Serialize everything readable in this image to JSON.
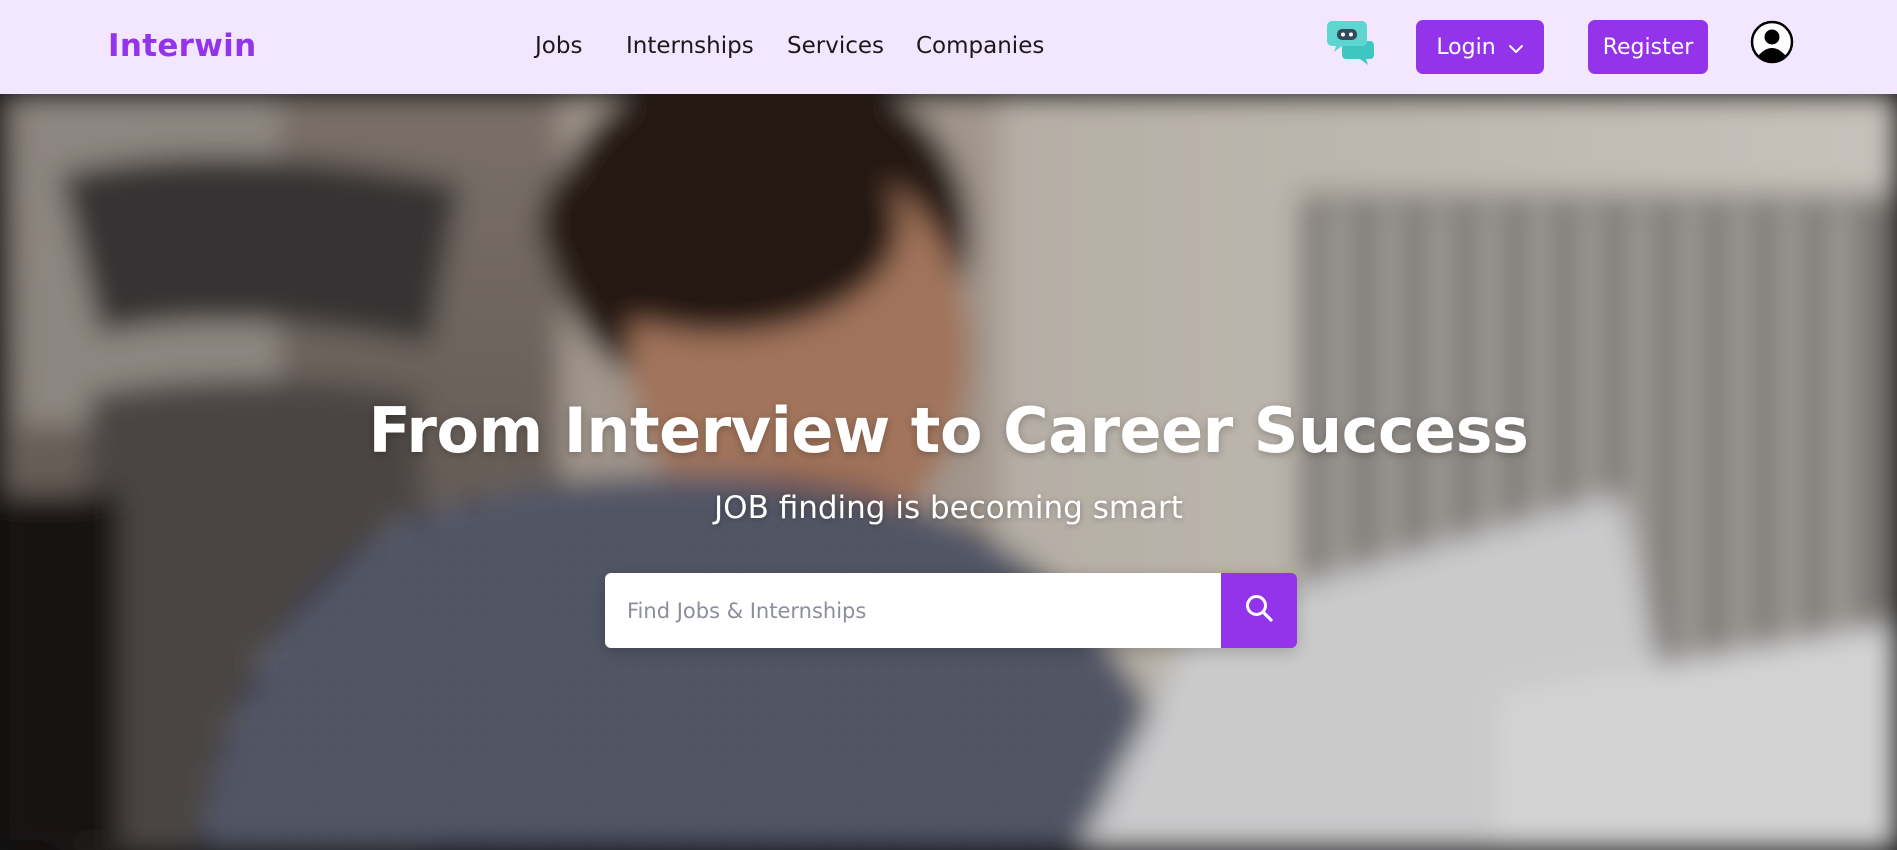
{
  "brand": {
    "name": "Interwin",
    "color": "#9333ea"
  },
  "nav": {
    "links": [
      "Jobs",
      "Internships",
      "Services",
      "Companies"
    ]
  },
  "header": {
    "chatbot_icon": "chatbot-icon",
    "login_label": "Login",
    "login_icon": "chevron-down-icon",
    "register_label": "Register",
    "avatar_icon": "user-avatar-icon",
    "navbar_bg": "#f3e6ff"
  },
  "hero": {
    "title": "From Interview to Career Success",
    "subtitle": "JOB finding is becoming smart",
    "background": "blurred photo of a smiling woman working on a laptop"
  },
  "search": {
    "placeholder": "Find Jobs & Internships",
    "value": "",
    "button_icon": "search-icon"
  }
}
